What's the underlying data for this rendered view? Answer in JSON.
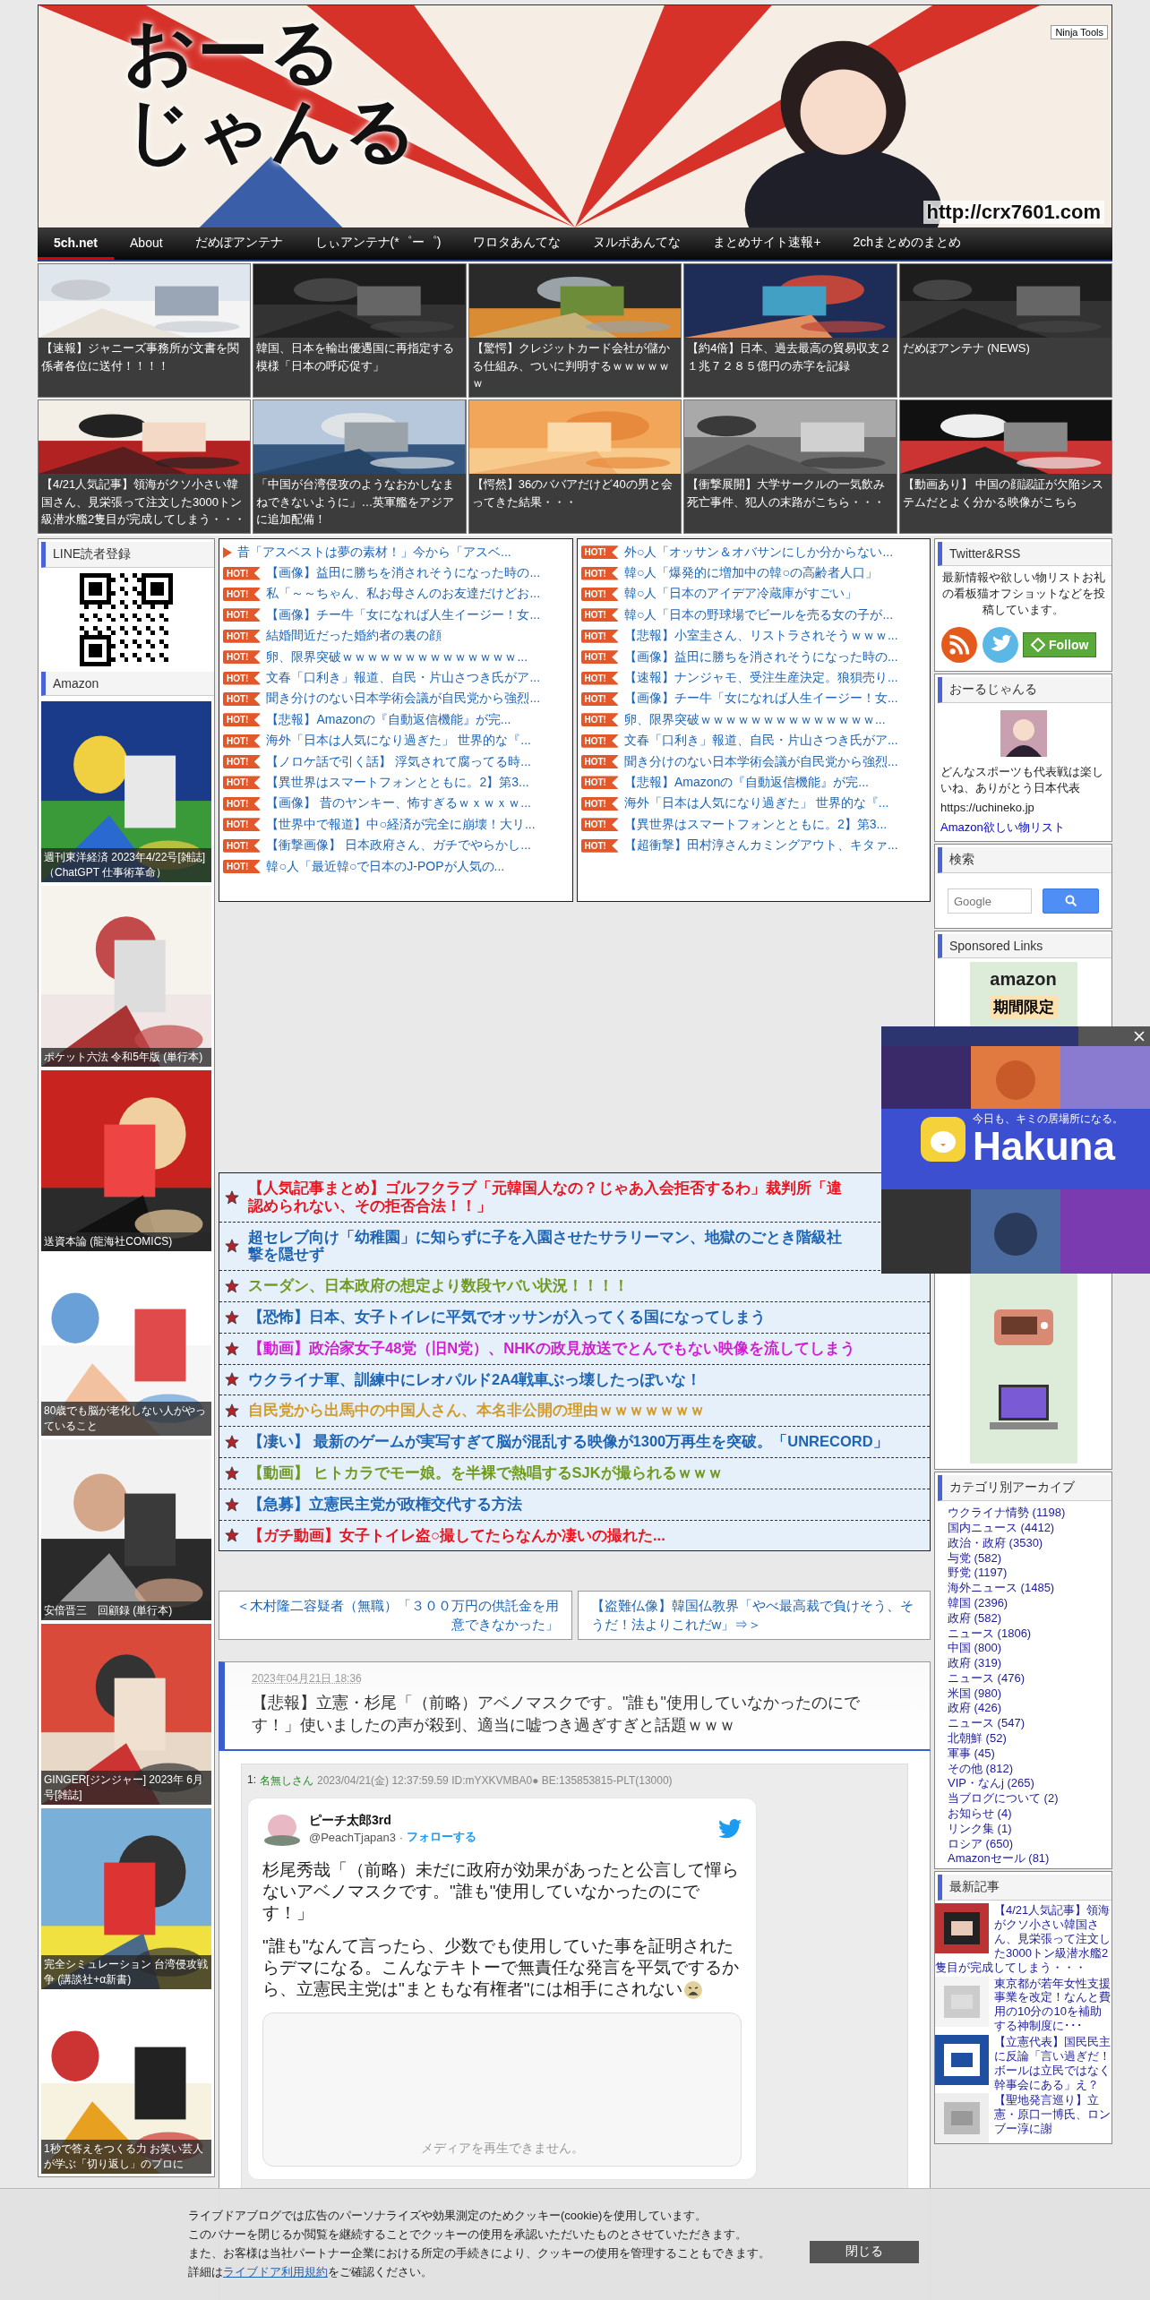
{
  "header": {
    "logo_lines": [
      "おーる",
      "じゃんる"
    ],
    "badge": "Ninja Tools",
    "url": "http://crx7601.com"
  },
  "nav": [
    {
      "label": "5ch.net",
      "selected": true
    },
    {
      "label": "About",
      "selected": false
    },
    {
      "label": "だめぽアンテナ",
      "selected": false
    },
    {
      "label": "しぃアンテナ(*゜ー゜)",
      "selected": false
    },
    {
      "label": "ワロタあんてな",
      "selected": false
    },
    {
      "label": "ヌルポあんてな",
      "selected": false
    },
    {
      "label": "まとめサイト速報+",
      "selected": false
    },
    {
      "label": "2chまとめのまとめ",
      "selected": false
    }
  ],
  "thumbs": [
    {
      "caption": "【速報】ジャニーズ事務所が文書を関係者各位に送付！！！！"
    },
    {
      "caption": "韓国、日本を輸出優遇国に再指定する模様「日本の呼応促す」"
    },
    {
      "caption": "【驚愕】クレジットカード会社が儲かる仕組み、ついに判明するｗｗｗｗｗｗ"
    },
    {
      "caption": "【約4倍】日本、過去最高の貿易収支２１兆７２８５億円の赤字を記録"
    },
    {
      "caption": "だめぽアンテナ (NEWS)"
    },
    {
      "caption": "【4/21人気記事】領海がクソ小さい韓国さん、見栄張って注文した3000トン級潜水艦2隻目が完成してしまう・・・"
    },
    {
      "caption": "「中国が台湾侵攻のようなおかしなまねできないように」…英軍艦をアジアに追加配備！"
    },
    {
      "caption": "【愕然】36のババアだけど40の男と会ってきた結果・・・"
    },
    {
      "caption": "【衝撃展開】大学サークルの一気飲み死亡事件、犯人の末路がこちら・・・"
    },
    {
      "caption": "【動画あり】 中国の顔認証が欠陥システムだとよく分かる映像がこちら"
    }
  ],
  "left_sidebar": {
    "line_title": "LINE読者登録",
    "amazon_title": "Amazon",
    "books": [
      {
        "caption": "週刊東洋経済 2023年4/22号[雑誌]（ChatGPT 仕事術革命）"
      },
      {
        "caption": "ポケット六法 令和5年版 (単行本)"
      },
      {
        "caption": "送資本論 (龍海社COMICS)"
      },
      {
        "caption": "80歳でも脳が老化しない人がやっていること"
      },
      {
        "caption": "安倍晋三　回顧録 (単行本)"
      },
      {
        "caption": "GINGER[ジンジャー] 2023年 6月号[雑誌]"
      },
      {
        "caption": "完全シミュレーション 台湾侵攻戦争 (講談社+α新書)"
      },
      {
        "caption": "1秒で答えをつくる力 お笑い芸人が学ぶ「切り返し」のプロに"
      }
    ]
  },
  "ranking_left": [
    {
      "kind": "arrow",
      "title": "昔「アスベストは夢の素材！」今から「アスベ..."
    },
    {
      "kind": "hot",
      "badge": "HOT!",
      "title": "【画像】益田に勝ちを消されそうになった時の..."
    },
    {
      "kind": "hot",
      "badge": "HOT!",
      "title": "私「～～ちゃん、私お母さんのお友達だけどお..."
    },
    {
      "kind": "hot",
      "badge": "HOT!",
      "title": "【画像】チー牛「女になれば人生イージー！女..."
    },
    {
      "kind": "hot",
      "badge": "HOT!",
      "title": "結婚間近だった婚約者の裏の顔"
    },
    {
      "kind": "hot",
      "badge": "HOT!",
      "title": "卵、限界突破ｗｗｗｗｗｗｗｗｗｗｗｗｗｗ..."
    },
    {
      "kind": "hot",
      "badge": "HOT!",
      "title": "文春「口利き」報道、自民・片山さつき氏がア..."
    },
    {
      "kind": "hot",
      "badge": "HOT!",
      "title": "聞き分けのない日本学術会議が自民党から強烈..."
    },
    {
      "kind": "hot",
      "badge": "HOT!",
      "title": "【悲報】Amazonの『自動返信機能』が完..."
    },
    {
      "kind": "hot",
      "badge": "HOT!",
      "title": "海外「日本は人気になり過ぎた」 世界的な『..."
    },
    {
      "kind": "hot",
      "badge": "HOT!",
      "title": "【ノロケ話で引く話】 浮気されて腐ってる時..."
    },
    {
      "kind": "hot",
      "badge": "HOT!",
      "title": "【異世界はスマートフォンとともに。2】第3..."
    },
    {
      "kind": "hot",
      "badge": "HOT!",
      "title": "【画像】 昔のヤンキー、怖すぎるｗｘｗｘｗ..."
    },
    {
      "kind": "hot",
      "badge": "HOT!",
      "title": "【世界中で報道】中○経済が完全に崩壊！大リ..."
    },
    {
      "kind": "hot",
      "badge": "HOT!",
      "title": "【衝撃画像】 日本政府さん、ガチでやらかし..."
    },
    {
      "kind": "hot",
      "badge": "HOT!",
      "title": "韓○人「最近韓○で日本のJ-POPが人気の..."
    }
  ],
  "ranking_right": [
    {
      "kind": "hot",
      "badge": "HOT!",
      "title": "外○人「オッサン＆オバサンにしか分からない..."
    },
    {
      "kind": "hot",
      "badge": "HOT!",
      "title": "韓○人「爆発的に増加中の韓○の高齢者人口」"
    },
    {
      "kind": "hot",
      "badge": "HOT!",
      "title": "韓○人「日本のアイデア冷蔵庫がすごい」"
    },
    {
      "kind": "hot",
      "badge": "HOT!",
      "title": "韓○人「日本の野球場でビールを売る女の子が..."
    },
    {
      "kind": "hot",
      "badge": "HOT!",
      "title": "【悲報】小室圭さん、リストラされそうｗｗｗ..."
    },
    {
      "kind": "hot",
      "badge": "HOT!",
      "title": "【画像】益田に勝ちを消されそうになった時の..."
    },
    {
      "kind": "hot",
      "badge": "HOT!",
      "title": "【速報】ナンジャモ、受注生産決定。狼狽売り..."
    },
    {
      "kind": "hot",
      "badge": "HOT!",
      "title": "【画像】チー牛「女になれば人生イージー！女..."
    },
    {
      "kind": "hot",
      "badge": "HOT!",
      "title": "卵、限界突破ｗｗｗｗｗｗｗｗｗｗｗｗｗｗ..."
    },
    {
      "kind": "hot",
      "badge": "HOT!",
      "title": "文春「口利き」報道、自民・片山さつき氏がア..."
    },
    {
      "kind": "hot",
      "badge": "HOT!",
      "title": "聞き分けのない日本学術会議が自民党から強烈..."
    },
    {
      "kind": "hot",
      "badge": "HOT!",
      "title": "【悲報】Amazonの『自動返信機能』が完..."
    },
    {
      "kind": "hot",
      "badge": "HOT!",
      "title": "海外「日本は人気になり過ぎた」 世界的な『..."
    },
    {
      "kind": "hot",
      "badge": "HOT!",
      "title": "【異世界はスマートフォンとともに。2】第3..."
    },
    {
      "kind": "hot",
      "badge": "HOT!",
      "title": "【超衝撃】田村淳さんカミングアウト、キタァ..."
    }
  ],
  "featured": [
    {
      "color": "#e8141e",
      "lines": [
        "【人気記事まとめ】ゴルフクラブ「元韓国人なの？じゃあ入会拒否するわ」裁判所「違",
        "認められない、その拒否合法！！」"
      ]
    },
    {
      "color": "#1e64b4",
      "lines": [
        "超セレブ向け「幼稚園」に知らずに子を入園させたサラリーマン、地獄のごとき階級社",
        "撃を隠せず"
      ]
    },
    {
      "color": "#6e9a1e",
      "lines": [
        "スーダン、日本政府の想定より数段ヤバい状況！！！！"
      ]
    },
    {
      "color": "#1e64b4",
      "lines": [
        "【恐怖】日本、女子トイレに平気でオッサンが入ってくる国になってしまう"
      ]
    },
    {
      "color": "#d21ed2",
      "lines": [
        "【動画】政治家女子48党（旧N党）、NHKの政見放送でとんでもない映像を流してしまう"
      ]
    },
    {
      "color": "#1e64b4",
      "lines": [
        "ウクライナ軍、訓練中にレオパルド2A4戦車ぶっ壊したっぽいな！"
      ]
    },
    {
      "color": "#d29b28",
      "lines": [
        "自民党から出馬中の中国人さん、本名非公開の理由ｗｗｗｗｗｗｗ"
      ]
    },
    {
      "color": "#1e64b4",
      "lines": [
        "【凄い】 最新のゲームが実写すぎて脳が混乱する映像が1300万再生を突破。「UNRECORD」"
      ]
    },
    {
      "color": "#6e9a1e",
      "lines": [
        "【動画】 ヒトカラでモー娘。を半裸で熱唱するSJKが撮られるｗｗｗ"
      ]
    },
    {
      "color": "#1e64b4",
      "lines": [
        "【急募】立憲民主党が政権交代する方法"
      ]
    },
    {
      "color": "#e8141e",
      "lines": [
        "【ガチ動画】女子トイレ盗○撮してたらなんか凄いの撮れた..."
      ]
    }
  ],
  "post_nav": {
    "prev": "＜木村隆二容疑者（無職）「３００万円の供託金を用意できなかった」",
    "next": "【盗難仏像】韓国仏教界「やべ最高裁で負けそう、そうだ！法よりこれだw」⇒＞"
  },
  "article": {
    "date": "2023年04月21日 18:36",
    "title": "【悲報】立憲・杉尾「（前略）アベノマスクです。\"誰も\"使用していなかったのにです！」使いましたの声が殺到、適当に嘘つき過ぎすぎと話題ｗｗｗ",
    "post": {
      "number": "1:",
      "name": "名無しさん",
      "meta": "2023/04/21(金) 12:37:59.59 ID:mYXKVMBA0● BE:135853815-PLT(13000)",
      "tweet": {
        "name": "ピーチ太郎3rd",
        "handle": "@PeachTjapan3 ·",
        "follow": "フォローする",
        "paragraphs": [
          "杉尾秀哉「（前略）未だに政府が効果があったと公言して憚らないアベノマスクです。\"誰も\"使用していなかったのにです！」",
          "\"誰も\"なんて言ったら、少数でも使用していた事を証明されたらデマになる。こんなテキトーで無責任な発言を平気でするから、立憲民主党は\"まともな有権者\"には相手にされない"
        ],
        "media_message": "メディアを再生できません。"
      }
    }
  },
  "right_sidebar": {
    "twitter": {
      "title": "Twitter&RSS",
      "text": "最新情報や欲しい物リストお礼の看板猫オフショットなどを投稿しています。",
      "follow": "Follow"
    },
    "profile": {
      "title": "おーるじゃんる",
      "text": "どんなスポーツも代表戦は楽しいね、ありがとう日本代表",
      "url": "https://uchineko.jp",
      "link": "Amazon欲しい物リスト"
    },
    "search": {
      "title": "検索",
      "placeholder": "Google"
    },
    "sponsored": {
      "title": "Sponsored Links",
      "brand": "amazon",
      "tag": "期間限定"
    },
    "categories": {
      "title": "カテゴリ別アーカイブ",
      "items": [
        "ウクライナ情勢 (1198)",
        "国内ニュース (4412)",
        "政治・政府 (3530)",
        "与党 (582)",
        "野党 (1197)",
        "海外ニュース (1485)",
        "韓国 (2396)",
        "政府 (582)",
        "ニュース (1806)",
        "中国 (800)",
        "政府 (319)",
        "ニュース (476)",
        "米国 (980)",
        "政府 (426)",
        "ニュース (547)",
        "北朝鮮 (52)",
        "軍事 (45)",
        "その他 (812)",
        "VIP・なんj (265)",
        "当ブログについて (2)",
        "お知らせ (4)",
        "リンク集 (1)",
        "ロシア (650)",
        "Amazonセール (81)"
      ]
    },
    "recent": {
      "title": "最新記事",
      "items": [
        "【4/21人気記事】領海がクソ小さい韓国さん、見栄張って注文した3000トン級潜水艦2隻目が完成してしまう・・・",
        "東京都が若年女性支援事業を改定！なんと費用の10分の10を補助する神制度に･･･",
        "【立憲代表】国民民主に反論「言い過ぎだ！ボールは立民ではなく幹事会にある」え？",
        "【聖地発言巡り】立憲・原口一博氏、ロンブー淳に謝"
      ]
    }
  },
  "overlay_ad": {
    "tagline": "今日も、キミの居場所になる。",
    "brand": "Hakuna"
  },
  "cookie_banner": {
    "lines": [
      "ライブドアブログでは広告のパーソナライズや効果測定のためクッキー(cookie)を使用しています。",
      "このバナーを閉じるか閲覧を継続することでクッキーの使用を承認いただいたものとさせていただきます。",
      "また、お客様は当社パートナー企業における所定の手続きにより、クッキーの使用を管理することもできます。"
    ],
    "prefix": "詳細は",
    "link": "ライブドア利用規約",
    "suffix": "をご確認ください。",
    "button": "閉じる"
  }
}
